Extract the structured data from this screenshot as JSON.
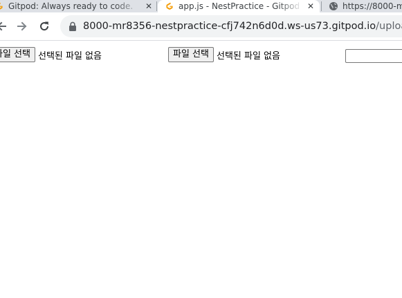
{
  "browser": {
    "tabs": [
      {
        "title": "Gitpod: Always ready to code.",
        "close_glyph": "✕",
        "icon": "gitpod-icon",
        "active": false
      },
      {
        "title": "app.js - NestPractice - Gitpod C",
        "close_glyph": "✕",
        "icon": "gitpod-icon",
        "active": true
      },
      {
        "title": "https://8000-m",
        "icon": "globe-icon",
        "active": false
      }
    ],
    "address_bar": {
      "host": "8000-mr8356-nestpractice-cfj742n6d0d.ws-us73.gitpod.io",
      "path": "/upload"
    },
    "colors": {
      "gitpod_orange": "#f59e0b",
      "tabstrip_bg": "#dee1e6",
      "omnibox_bg": "#f1f3f4"
    }
  },
  "page": {
    "file_inputs": [
      {
        "button_label": "파일 선택",
        "status": "선택된 파일 없음"
      },
      {
        "button_label": "파일 선택",
        "status": "선택된 파일 없음"
      }
    ],
    "text_input": {
      "value": ""
    }
  }
}
